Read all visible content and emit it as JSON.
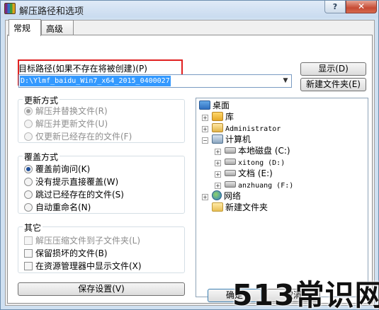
{
  "window": {
    "title": "解压路径和选项",
    "help_glyph": "?",
    "close_glyph": "✕"
  },
  "tabs": [
    {
      "label": "常规"
    },
    {
      "label": "高级"
    }
  ],
  "dest": {
    "label": "目标路径(如果不存在将被创建)(P)",
    "path_value": "D:\\Ylmf_baidu_Win7_x64_2015_0400027",
    "arrow": "▼"
  },
  "buttons": {
    "show": "显示(D)",
    "new_folder": "新建文件夹(E)",
    "save_settings": "保存设置(V)",
    "ok": "确定",
    "cancel": "取消"
  },
  "update_mode": {
    "title": "更新方式",
    "options": [
      "解压并替换文件(R)",
      "解压并更新文件(U)",
      "仅更新已经存在的文件(F)"
    ]
  },
  "overwrite_mode": {
    "title": "覆盖方式",
    "options": [
      "覆盖前询问(K)",
      "没有提示直接覆盖(W)",
      "跳过已经存在的文件(S)",
      "自动重命名(N)"
    ]
  },
  "misc": {
    "title": "其它",
    "options": [
      "解压压缩文件到子文件夹(L)",
      "保留损坏的文件(B)",
      "在资源管理器中显示文件(X)"
    ]
  },
  "tree": {
    "desktop": "桌面",
    "library": "库",
    "user": "Administrator",
    "computer": "计算机",
    "drives": [
      "本地磁盘 (C:)",
      "xitong (D:)",
      "文档 (E:)",
      "anzhuang (F:)"
    ],
    "network": "网络",
    "new_folder": "新建文件夹",
    "expand_plus": "+",
    "expand_minus": "−"
  },
  "watermark": "513常识网"
}
